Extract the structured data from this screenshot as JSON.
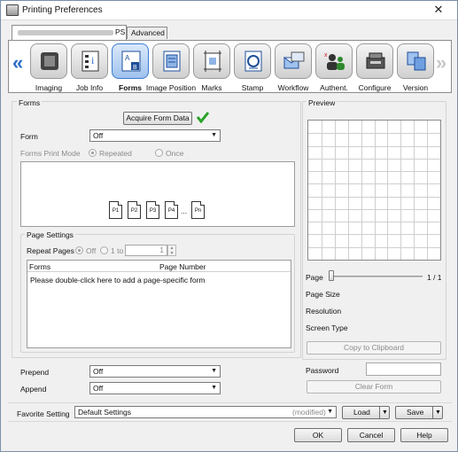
{
  "window": {
    "title": "Printing Preferences"
  },
  "tabs": [
    {
      "label": "PS"
    },
    {
      "label": "Advanced"
    }
  ],
  "ribbon": {
    "items": [
      {
        "label": "Imaging",
        "icon": "imaging-icon"
      },
      {
        "label": "Job Info",
        "icon": "job-info-icon"
      },
      {
        "label": "Forms",
        "icon": "forms-icon",
        "selected": true
      },
      {
        "label": "Image Position",
        "icon": "image-position-icon"
      },
      {
        "label": "Marks",
        "icon": "marks-icon"
      },
      {
        "label": "Stamp",
        "icon": "stamp-icon"
      },
      {
        "label": "Workflow",
        "icon": "workflow-icon"
      },
      {
        "label": "Authent.",
        "icon": "authentication-icon"
      },
      {
        "label": "Configure",
        "icon": "configure-icon"
      },
      {
        "label": "Version",
        "icon": "version-icon"
      }
    ]
  },
  "forms": {
    "group_label": "Forms",
    "acquire_button": "Acquire Form Data",
    "form_label": "Form",
    "form_value": "Off",
    "print_mode_label": "Forms Print Mode",
    "mode_repeated": "Repeated",
    "mode_once": "Once",
    "pages": [
      "P1",
      "P2",
      "P3",
      "P4",
      "Pn"
    ],
    "ellipsis": "..."
  },
  "page_settings": {
    "group_label": "Page Settings",
    "repeat_label": "Repeat Pages",
    "off_label": "Off",
    "one_to_label": "1 to",
    "pages_value": "1",
    "col_forms": "Forms",
    "col_page_number": "Page Number",
    "hint": "Please double-click here to add a page-specific form"
  },
  "prepend": {
    "label": "Prepend",
    "value": "Off"
  },
  "append": {
    "label": "Append",
    "value": "Off"
  },
  "preview": {
    "group_label": "Preview",
    "page_label": "Page",
    "page_count": "1 / 1",
    "page_size_label": "Page Size",
    "resolution_label": "Resolution",
    "screen_type_label": "Screen Type",
    "copy_button": "Copy to Clipboard",
    "password_label": "Password",
    "password_value": "",
    "clear_button": "Clear Form"
  },
  "favorite": {
    "label": "Favorite Setting",
    "value": "Default Settings",
    "modified": "(modified)",
    "load_button": "Load",
    "save_button": "Save"
  },
  "dialog_buttons": {
    "ok": "OK",
    "cancel": "Cancel",
    "help": "Help"
  },
  "colors": {
    "accent": "#2c6fc7",
    "check_green": "#29a329"
  }
}
